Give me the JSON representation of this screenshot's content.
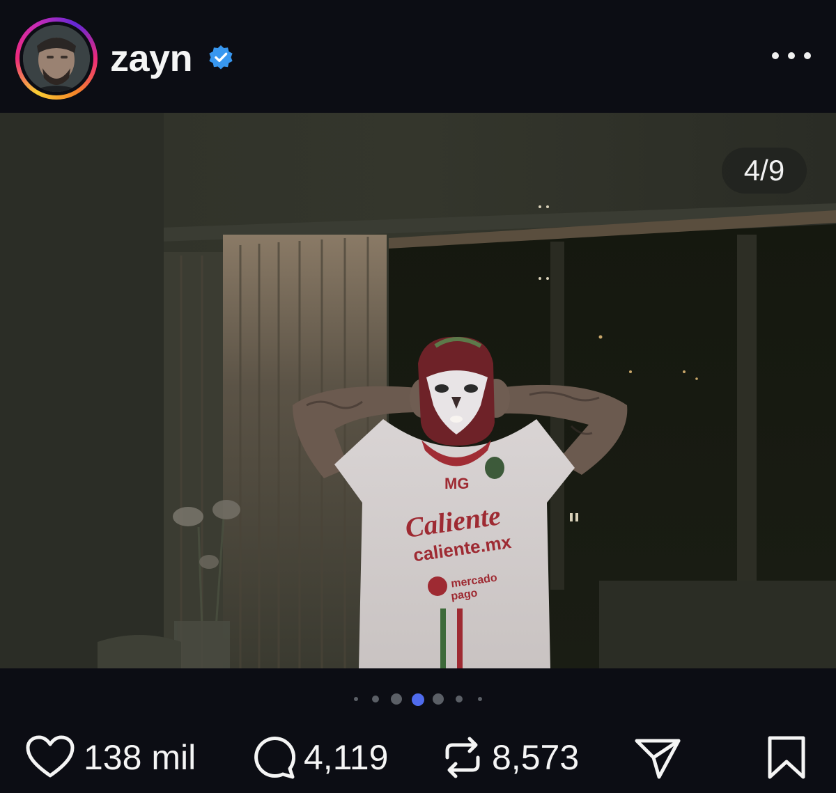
{
  "post": {
    "username": "zayn",
    "verified": true,
    "slide_counter": "4/9",
    "current_slide": 4,
    "total_slides": 9,
    "image_description_icon": "photo"
  },
  "actions": {
    "likes": "138 mil",
    "comments": "4,119",
    "reposts": "8,573"
  },
  "colors": {
    "background": "#0c0d14",
    "verified_badge": "#3897f0",
    "active_dot": "#4f6bed",
    "inactive_dot": "#5b5f66"
  },
  "icons": [
    "heart-icon",
    "comment-icon",
    "repost-icon",
    "share-icon",
    "bookmark-icon",
    "more-icon",
    "verified-icon"
  ]
}
